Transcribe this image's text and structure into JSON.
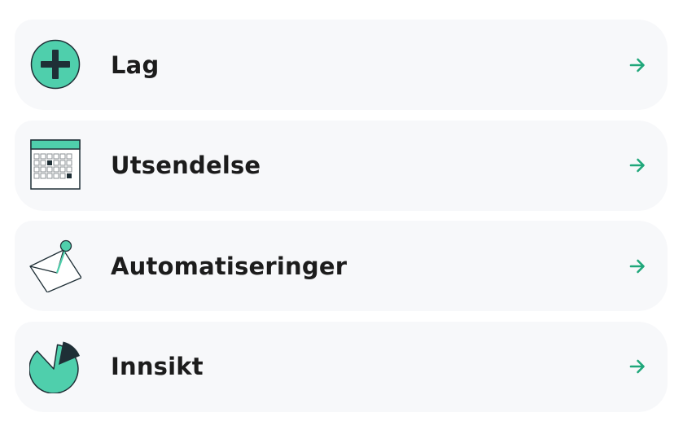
{
  "colors": {
    "accent": "#4fcfac",
    "arrow": "#1fa77a",
    "card_bg": "#f7f8fa",
    "text": "#1c1c1c",
    "dark": "#1f2f36"
  },
  "menu": {
    "items": [
      {
        "label": "Lag",
        "icon": "plus-circle-icon"
      },
      {
        "label": "Utsendelse",
        "icon": "calendar-icon"
      },
      {
        "label": "Automatiseringer",
        "icon": "envelope-icon"
      },
      {
        "label": "Innsikt",
        "icon": "pie-chart-icon"
      }
    ]
  }
}
